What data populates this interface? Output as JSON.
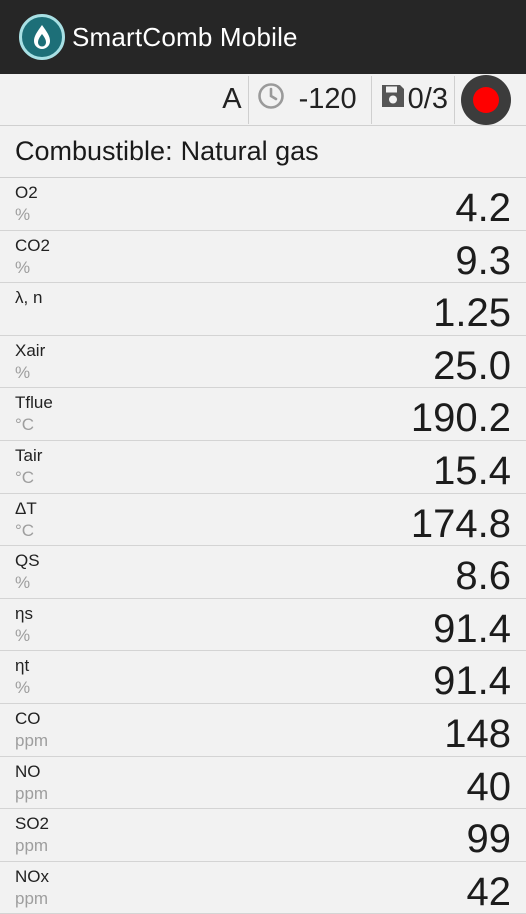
{
  "app": {
    "title": "SmartComb Mobile",
    "icon": "smartcomb-flame-icon"
  },
  "toolbar": {
    "mode": "A",
    "timer_icon": "clock-icon",
    "timer_value": "-120",
    "save_icon": "floppy-disk-icon",
    "save_count": "0/3",
    "record_color": "#ff0000"
  },
  "fuel": {
    "label": "Combustible:",
    "value": "Natural gas"
  },
  "rows": [
    {
      "param": "O2",
      "unit": "%",
      "value": "4.2"
    },
    {
      "param": "CO2",
      "unit": "%",
      "value": "9.3"
    },
    {
      "param": "λ, n",
      "unit": "",
      "value": "1.25"
    },
    {
      "param": "Xair",
      "unit": "%",
      "value": "25.0"
    },
    {
      "param": "Tflue",
      "unit": "°C",
      "value": "190.2"
    },
    {
      "param": "Tair",
      "unit": "°C",
      "value": "15.4"
    },
    {
      "param": "ΔT",
      "unit": "°C",
      "value": "174.8"
    },
    {
      "param": "QS",
      "unit": "%",
      "value": "8.6"
    },
    {
      "param": "ηs",
      "unit": "%",
      "value": "91.4"
    },
    {
      "param": "ηt",
      "unit": "%",
      "value": "91.4"
    },
    {
      "param": "CO",
      "unit": "ppm",
      "value": "148"
    },
    {
      "param": "NO",
      "unit": "ppm",
      "value": "40"
    },
    {
      "param": "SO2",
      "unit": "ppm",
      "value": "99"
    },
    {
      "param": "NOx",
      "unit": "ppm",
      "value": "42"
    }
  ]
}
